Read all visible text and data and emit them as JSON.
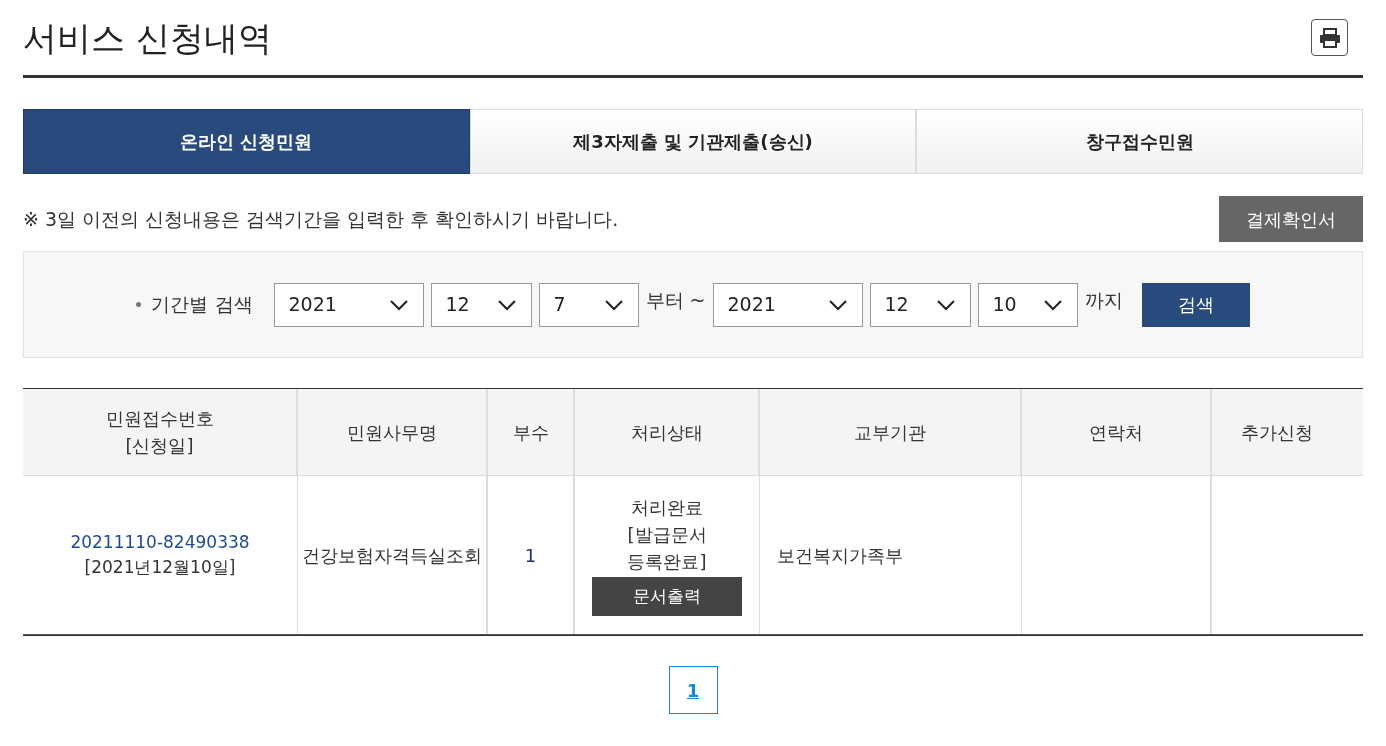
{
  "page_title": "서비스 신청내역",
  "tabs": [
    {
      "label": "온라인 신청민원",
      "selected": true
    },
    {
      "label": "제3자제출 및 기관제출(송신)",
      "selected": false
    },
    {
      "label": "창구접수민원",
      "selected": false
    }
  ],
  "notice": "※ 3일 이전의 신청내용은 검색기간을 입력한 후 확인하시기 바랍니다.",
  "payment_button": "결제확인서",
  "search": {
    "label": "기간별 검색",
    "from": [
      "2021",
      "12",
      "7"
    ],
    "from_suffix": "부터 ~",
    "to": [
      "2021",
      "12",
      "10"
    ],
    "to_suffix": "까지",
    "button": "검색"
  },
  "table": {
    "columns": [
      [
        "민원접수번호",
        "[신청일]"
      ],
      [
        "민원사무명"
      ],
      [
        "부수"
      ],
      [
        "처리상태"
      ],
      [
        "교부기관"
      ],
      [
        "연락처"
      ],
      [
        "추가신청"
      ]
    ],
    "rows": [
      {
        "number": "20211110-82490338",
        "date": "[2021년12월10일]",
        "name": "건강보험자격득실조회",
        "copies": "1",
        "status": [
          "처리완료",
          "[발급문서",
          "등록완료]"
        ],
        "status_button": "문서출력",
        "agency": "보건복지가족부"
      }
    ]
  },
  "pagination": [
    {
      "label": "1",
      "selected": true
    }
  ]
}
